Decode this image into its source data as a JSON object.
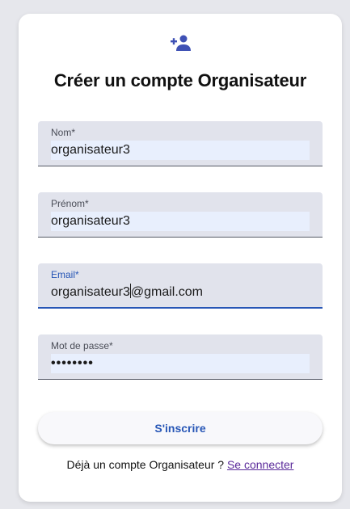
{
  "header": {
    "icon": "person-add-icon",
    "title": "Créer un compte Organisateur"
  },
  "form": {
    "nom": {
      "label": "Nom*",
      "value": "organisateur3"
    },
    "prenom": {
      "label": "Prénom*",
      "value": "organisateur3"
    },
    "email": {
      "label": "Email*",
      "value_before_caret": "organisateur3",
      "value_after_caret": "@gmail.com"
    },
    "password": {
      "label": "Mot de passe*",
      "value": "••••••••"
    }
  },
  "submit_label": "S'inscrire",
  "footer": {
    "text": "Déjà un compte Organisateur ? ",
    "link": "Se connecter"
  },
  "colors": {
    "accent": "#2756b6",
    "icon": "#3f51b5",
    "link": "#5a2a9a",
    "field_bg": "#e1e3ec"
  }
}
